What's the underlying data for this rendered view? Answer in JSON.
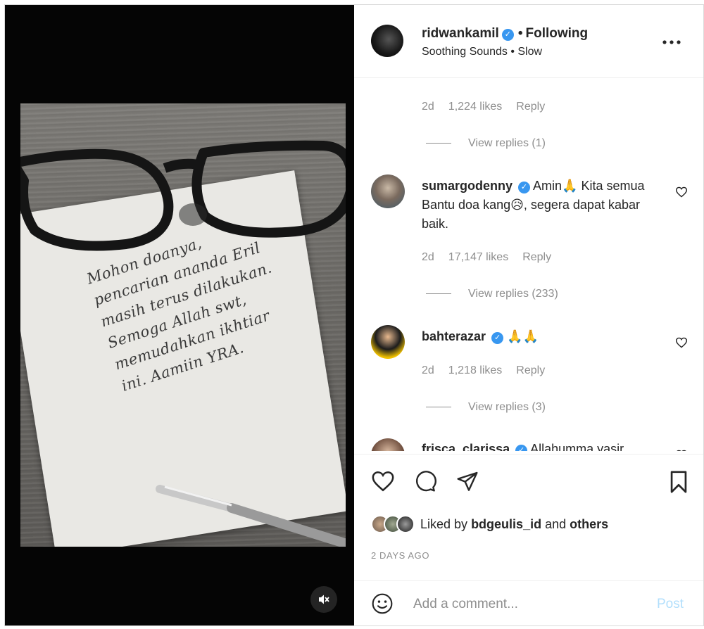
{
  "header": {
    "username": "ridwankamil",
    "verified_mark": "✓",
    "separator": "•",
    "follow_label": "Following",
    "audio": "Soothing Sounds • Slow",
    "more_icon": "more-horizontal-icon"
  },
  "media": {
    "note_lines": [
      "Mohon doanya,",
      "pencarian ananda Eril",
      "masih terus dilakukan.",
      "Semoga Allah swt,",
      "memudahkan ikhtiar",
      "ini. Aamiin YRA."
    ],
    "mute_icon": "speaker-muted-icon"
  },
  "comments": {
    "top_meta": {
      "age": "2d",
      "likes": "1,224 likes",
      "reply": "Reply"
    },
    "top_view_replies": "View replies (1)",
    "items": [
      {
        "username": "sumargodenny",
        "text": "Amin🙏 Kita semua Bantu doa kang😥, segera dapat kabar baik.",
        "age": "2d",
        "likes": "17,147 likes",
        "reply": "Reply",
        "view_replies": "View replies (233)"
      },
      {
        "username": "bahterazar",
        "text": "🙏🙏",
        "age": "2d",
        "likes": "1,218 likes",
        "reply": "Reply",
        "view_replies": "View replies (3)"
      },
      {
        "username": "frisca_clarissa",
        "text": "Allahumma yasir"
      }
    ]
  },
  "actions": {
    "icons": [
      "heart-icon",
      "comment-icon",
      "share-icon",
      "bookmark-icon"
    ],
    "liked_by_prefix": "Liked by",
    "liked_by_user": "bdgeulis_id",
    "liked_by_and": "and",
    "liked_by_others": "others",
    "posted_ago": "2 DAYS AGO"
  },
  "add_comment": {
    "placeholder": "Add a comment...",
    "post_label": "Post"
  },
  "colors": {
    "accent": "#3897f0",
    "post_disabled": "#b2dffc",
    "muted_text": "#8e8e8e"
  }
}
